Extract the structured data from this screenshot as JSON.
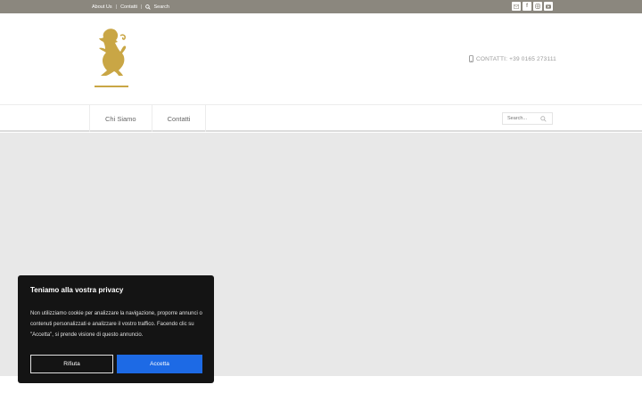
{
  "topbar": {
    "links": [
      "About Us",
      "Contatti"
    ],
    "search_label": "Search",
    "social": [
      "mail-icon",
      "facebook-icon",
      "instagram-icon",
      "youtube-icon"
    ]
  },
  "header": {
    "logo": "lion-logo",
    "phone": "CONTATTI: +39 0165 273111"
  },
  "nav": {
    "items": [
      "Chi Siamo",
      "Contatti"
    ],
    "search_placeholder": "Search..."
  },
  "cookie_banner": {
    "title": "Teniamo alla vostra privacy",
    "text": "Non utilizziamo cookie per analizzare la navigazione, proporre annunci o contenuti personalizzati e analizzare il vostro traffico. Facendo clic su \"Accetta\", si prende visione di questo annuncio.",
    "reject_label": "Rifiuta",
    "accept_label": "Accetta"
  },
  "colors": {
    "topbar": "#8b877e",
    "accent_gold": "#c9a645",
    "accept_button": "#1d6ae5",
    "banner_bg": "#141414",
    "content_bg": "#e8e8e8"
  }
}
